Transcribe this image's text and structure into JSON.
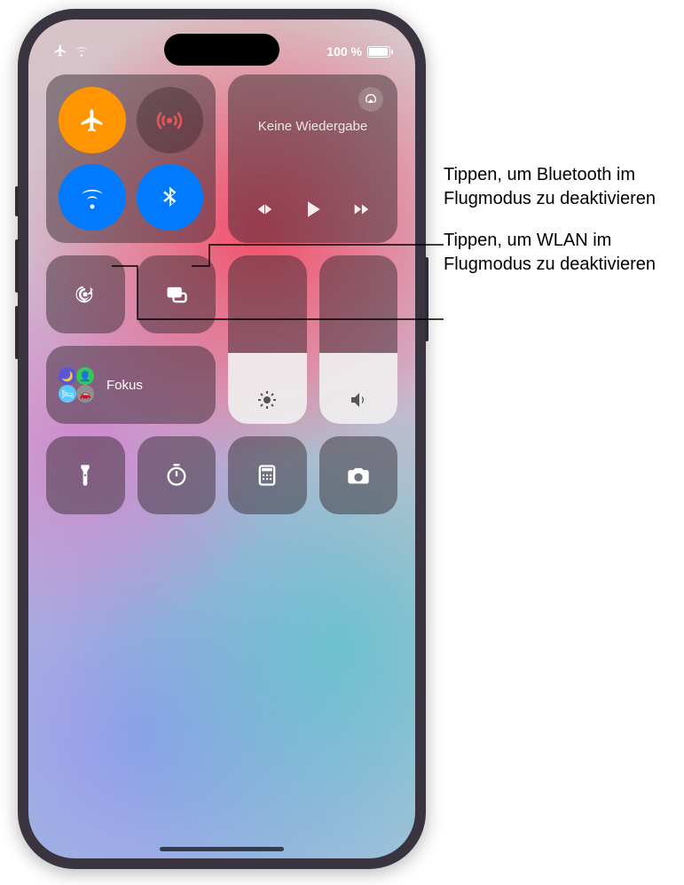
{
  "status": {
    "battery_pct": "100 %"
  },
  "media": {
    "title": "Keine Wiedergabe"
  },
  "focus": {
    "label": "Fokus"
  },
  "toggles": {
    "airplane": {
      "name": "airplane-mode",
      "on": true
    },
    "cellular": {
      "name": "cellular-data",
      "on": false
    },
    "wifi": {
      "name": "wifi",
      "on": true
    },
    "bluetooth": {
      "name": "bluetooth",
      "on": true
    }
  },
  "sliders": {
    "brightness_pct": 42,
    "volume_pct": 42
  },
  "shortcuts": [
    "flashlight",
    "timer",
    "calculator",
    "camera"
  ],
  "callouts": {
    "bluetooth": "Tippen, um Bluetooth im Flugmodus zu deaktivieren",
    "wifi": "Tippen, um WLAN im Flugmodus zu deaktivieren"
  }
}
